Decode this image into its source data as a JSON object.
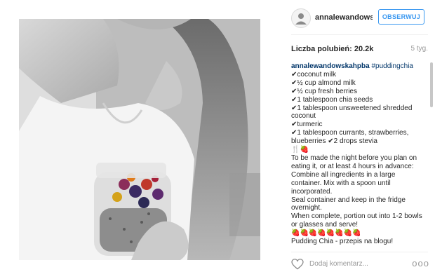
{
  "post": {
    "username_display": "annalewandows...",
    "username_full": "annalewandowskahpba",
    "follow_label": "OBSERWUJ",
    "likes_text": "Liczba polubień: 20.2k",
    "age_text": "5 tyg.",
    "hashtag": "#puddingchia",
    "caption_lines": [
      "✔coconut milk",
      "✔½ cup almond milk",
      "✔½ cup fresh berries",
      "✔1 tablespoon chia seeds",
      "✔1 tablespoon unsweetened shredded coconut",
      "✔turmeric",
      "✔1 tablespoon currants, strawberries, blueberries ✔2 drops stevia",
      "🍴🍓",
      "To be made the night before you plan on eating it, or at least 4 hours in advance:",
      "Combine all ingredients in a large container. Mix with a spoon until incorporated.",
      "Seal container and keep in the fridge overnight.",
      "When complete, portion out into 1-2 bowls or glasses and serve!",
      "🍓🍓🍓🍓🍓🍓🍓🍓",
      "Pudding Chia - przepis na blogu!"
    ],
    "comment_placeholder": "Dodaj komentarz...",
    "more_glyph": "ooo"
  },
  "icons": {
    "avatar": "avatar-icon",
    "heart": "heart-icon",
    "more": "more-options-icon"
  },
  "colors": {
    "accent": "#3897f0",
    "username": "#262626",
    "link": "#003569",
    "muted": "#999999",
    "divider": "#efefef"
  }
}
